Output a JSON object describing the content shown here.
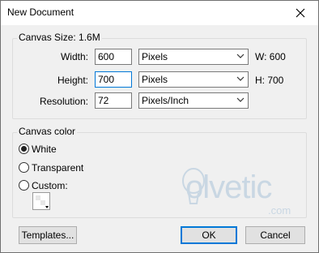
{
  "window": {
    "title": "New Document"
  },
  "canvas_size": {
    "label": "Canvas Size: 1.6M",
    "width": {
      "label": "Width:",
      "value": "600",
      "unit": "Pixels",
      "readout": "W: 600"
    },
    "height": {
      "label": "Height:",
      "value": "700",
      "unit": "Pixels",
      "readout": "H: 700"
    },
    "resolution": {
      "label": "Resolution:",
      "value": "72",
      "unit": "Pixels/Inch"
    }
  },
  "canvas_color": {
    "label": "Canvas color",
    "options": [
      {
        "label": "White",
        "checked": true
      },
      {
        "label": "Transparent",
        "checked": false
      },
      {
        "label": "Custom:",
        "checked": false
      }
    ]
  },
  "buttons": {
    "templates": "Templates...",
    "ok": "OK",
    "cancel": "Cancel"
  },
  "watermark": {
    "text": "olvetic",
    "domain": ".com"
  }
}
